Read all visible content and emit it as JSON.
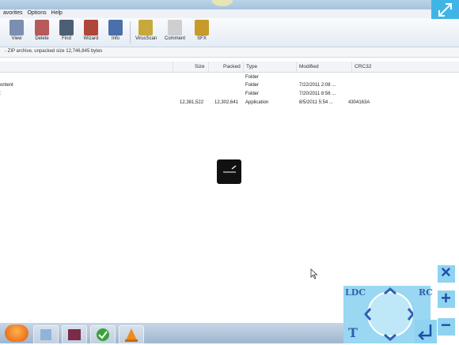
{
  "menu": [
    "avorites",
    "Options",
    "Help"
  ],
  "toolbar": {
    "buttons": [
      {
        "label": "View",
        "icon": "view-icon",
        "color": "#7a8fb0"
      },
      {
        "label": "Delete",
        "icon": "delete-icon",
        "color": "#b85a5a"
      },
      {
        "label": "Find",
        "icon": "find-icon",
        "color": "#4c5f74"
      },
      {
        "label": "Wizard",
        "icon": "wizard-icon",
        "color": "#b0453a"
      },
      {
        "label": "Info",
        "icon": "info-icon",
        "color": "#4b6fa8"
      },
      {
        "label": "VirusScan",
        "icon": "virusscan-icon",
        "color": "#c6a93a"
      },
      {
        "label": "Comment",
        "icon": "comment-icon",
        "color": "#cfcfcf"
      },
      {
        "label": "SFX",
        "icon": "sfx-icon",
        "color": "#c79a2a"
      }
    ]
  },
  "address": "- ZIP archive, unpacked size 12,746,845 bytes",
  "columns": [
    "Size",
    "Packed",
    "Type",
    "Modified",
    "CRC32"
  ],
  "rows": [
    {
      "name": "",
      "size": "",
      "packed": "",
      "type": "Folder",
      "modified": "",
      "crc": ""
    },
    {
      "name": "ontent",
      "size": "",
      "packed": "",
      "type": "Folder",
      "modified": "7/22/2011 2:08 ...",
      "crc": ""
    },
    {
      "name": "",
      "size": "",
      "packed": "",
      "type": "Folder",
      "modified": "7/20/2011 8:56 ...",
      "crc": ""
    },
    {
      "name": "",
      "size": "12,381,522",
      "packed": "12,302,641",
      "type": "Application",
      "modified": "8/5/2011 5:54 ...",
      "crc": "4304163A"
    }
  ],
  "controls": {
    "left_click": "LDC",
    "right_click": "RC",
    "text": "T",
    "close": "×",
    "zoom_in": "+",
    "zoom_out": "−"
  },
  "colors": {
    "accent": "#3fb5e6",
    "pad": "#8fd3f1",
    "pad_text": "#1c4ea8"
  }
}
